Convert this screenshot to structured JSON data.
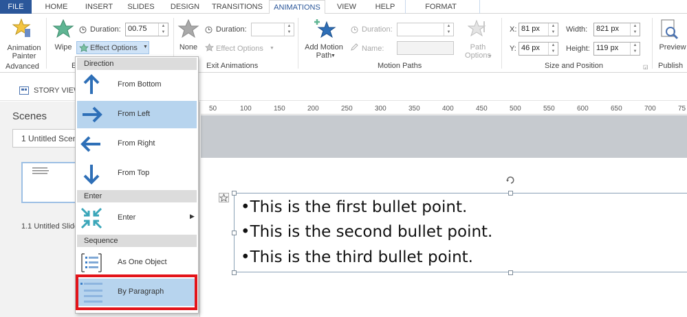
{
  "tabs": [
    "FILE",
    "HOME",
    "INSERT",
    "SLIDES",
    "DESIGN",
    "TRANSITIONS",
    "ANIMATIONS",
    "VIEW",
    "HELP",
    "FORMAT"
  ],
  "ribbon": {
    "advanced": {
      "button": "Animation Painter",
      "group": "Advanced"
    },
    "entrance": {
      "effect": "Wipe",
      "duration_label": "Duration:",
      "duration": "00.75",
      "effect_options": "Effect Options",
      "group_partial": "E"
    },
    "exit": {
      "effect": "None",
      "duration_label": "Duration:",
      "effect_options": "Effect Options",
      "group": "Exit Animations"
    },
    "motion": {
      "add_path": "Add Motion Path",
      "duration_label": "Duration:",
      "name_label": "Name:",
      "path_options": "Path Options",
      "group": "Motion Paths"
    },
    "size": {
      "x_label": "X:",
      "x": "81 px",
      "y_label": "Y:",
      "y": "46 px",
      "width_label": "Width:",
      "width": "821 px",
      "height_label": "Height:",
      "height": "119 px",
      "group": "Size and Position"
    },
    "publish": {
      "preview": "Preview",
      "group": "Publish"
    }
  },
  "story_view": "STORY VIEW",
  "scenes": {
    "title": "Scenes",
    "selected": "1 Untitled Scene",
    "thumb_label": "1.1 Untitled Slide"
  },
  "ruler": [
    "50",
    "100",
    "150",
    "200",
    "250",
    "300",
    "350",
    "400",
    "450",
    "500",
    "550",
    "600",
    "650",
    "700",
    "75"
  ],
  "slide": {
    "bullets": [
      "•This is the first bullet point.",
      "•This is the second bullet point.",
      "•This is the third bullet point."
    ]
  },
  "menu": {
    "direction_header": "Direction",
    "direction_items": [
      "From Bottom",
      "From Left",
      "From Right",
      "From Top"
    ],
    "enter_header": "Enter",
    "enter_item": "Enter",
    "sequence_header": "Sequence",
    "sequence_items": [
      "As One Object",
      "By Paragraph"
    ]
  },
  "colors": {
    "accent": "#2b579a",
    "menu_selected": "#b7d4ee",
    "highlight": "#e3141a"
  }
}
